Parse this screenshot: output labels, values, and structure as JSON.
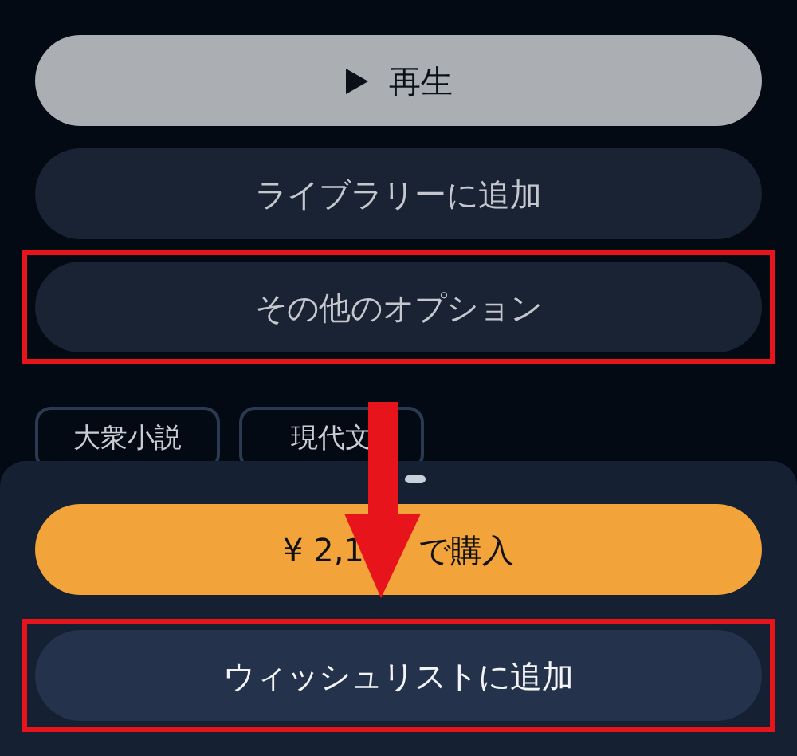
{
  "buttons": [
    {
      "kind": "play",
      "label": "再生",
      "highlighted": false
    },
    {
      "kind": "secondary",
      "label": "ライブラリーに追加",
      "highlighted": false
    },
    {
      "kind": "secondary",
      "label": "その他のオプション",
      "highlighted": true
    }
  ],
  "tags": [
    "大衆小説",
    "現代文"
  ],
  "sheet": {
    "buttons": [
      {
        "kind": "primary",
        "label_parts": [
          "¥ 2,1",
          "で購入"
        ],
        "highlighted": false
      },
      {
        "kind": "light",
        "label": "ウィッシュリストに追加",
        "highlighted": true
      }
    ]
  },
  "annotation_arrow": true
}
